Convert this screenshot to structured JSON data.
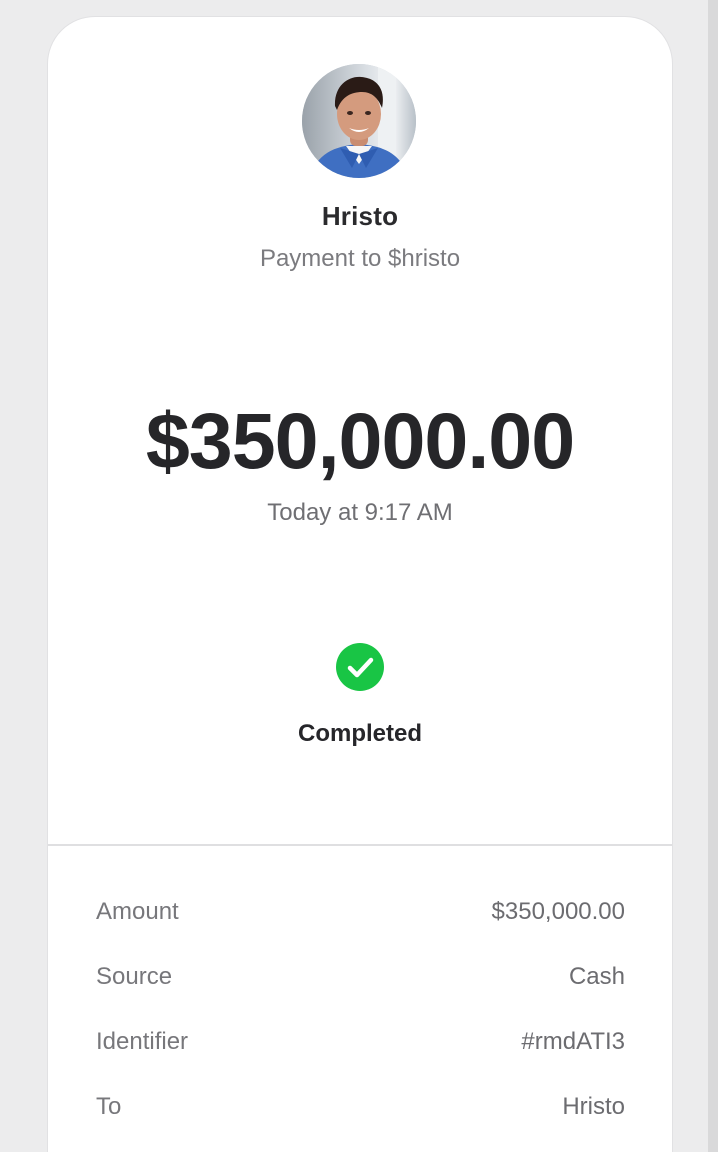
{
  "payment": {
    "recipient_name": "Hristo",
    "subtitle": "Payment to $hristo",
    "amount": "$350,000.00",
    "timestamp": "Today at 9:17 AM"
  },
  "status": {
    "label": "Completed",
    "icon": "checkmark-circle-icon",
    "color": "#19c545"
  },
  "details": [
    {
      "label": "Amount",
      "value": "$350,000.00"
    },
    {
      "label": "Source",
      "value": "Cash"
    },
    {
      "label": "Identifier",
      "value": "#rmdATI3"
    },
    {
      "label": "To",
      "value": "Hristo"
    }
  ]
}
